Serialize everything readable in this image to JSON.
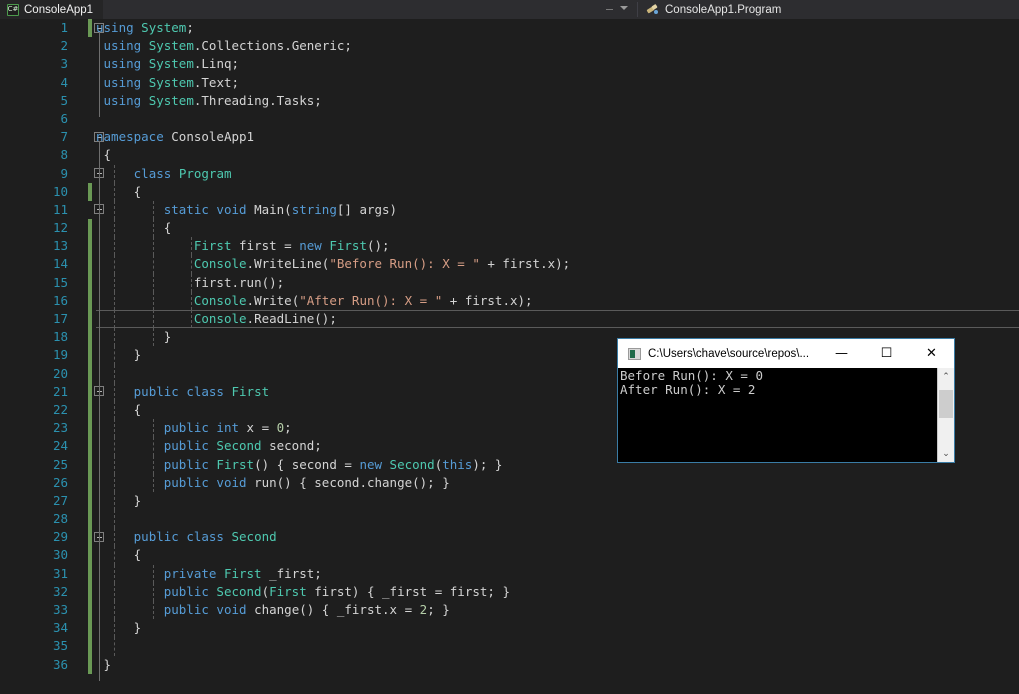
{
  "window": {
    "tab_title": "ConsoleApp1",
    "tab_icon": "csharp-file-icon",
    "nav_caret_icon": "chevron-down-icon",
    "nav_member_icon": "method-icon",
    "nav_member": "ConsoleApp1.Program"
  },
  "editor": {
    "current_line": 17,
    "lines": [
      {
        "n": "1",
        "text": "using System;",
        "fold": "collapse",
        "change": "green",
        "guides": []
      },
      {
        "n": "2",
        "text": " using System.Collections.Generic;",
        "fold": "none",
        "change": "none",
        "guides": []
      },
      {
        "n": "3",
        "text": " using System.Linq;",
        "fold": "none",
        "change": "none",
        "guides": []
      },
      {
        "n": "4",
        "text": " using System.Text;",
        "fold": "none",
        "change": "none",
        "guides": []
      },
      {
        "n": "5",
        "text": " using System.Threading.Tasks;",
        "fold": "none",
        "change": "none",
        "guides": []
      },
      {
        "n": "6",
        "text": "",
        "fold": "none",
        "change": "none",
        "guides": []
      },
      {
        "n": "7",
        "text": "namespace ConsoleApp1",
        "fold": "collapse",
        "change": "none",
        "guides": []
      },
      {
        "n": "8",
        "text": " {",
        "fold": "none",
        "change": "none",
        "guides": []
      },
      {
        "n": "9",
        "text": "     class Program",
        "fold": "collapse",
        "change": "none",
        "guides": [
          1
        ]
      },
      {
        "n": "10",
        "text": "     {",
        "fold": "none",
        "change": "green",
        "guides": [
          1
        ]
      },
      {
        "n": "11",
        "text": "         static void Main(string[] args)",
        "fold": "collapse",
        "change": "none",
        "guides": [
          1,
          2
        ]
      },
      {
        "n": "12",
        "text": "         {",
        "fold": "none",
        "change": "green",
        "guides": [
          1,
          2
        ]
      },
      {
        "n": "13",
        "text": "             First first = new First();",
        "fold": "none",
        "change": "green",
        "guides": [
          1,
          2,
          3
        ]
      },
      {
        "n": "14",
        "text": "             Console.WriteLine(\"Before Run(): X = \" + first.x);",
        "fold": "none",
        "change": "green",
        "guides": [
          1,
          2,
          3
        ]
      },
      {
        "n": "15",
        "text": "             first.run();",
        "fold": "none",
        "change": "green",
        "guides": [
          1,
          2,
          3
        ]
      },
      {
        "n": "16",
        "text": "             Console.Write(\"After Run(): X = \" + first.x);",
        "fold": "none",
        "change": "green",
        "guides": [
          1,
          2,
          3
        ]
      },
      {
        "n": "17",
        "text": "             Console.ReadLine();",
        "fold": "none",
        "change": "green",
        "guides": [
          1,
          2,
          3
        ]
      },
      {
        "n": "18",
        "text": "         }",
        "fold": "none",
        "change": "green",
        "guides": [
          1,
          2
        ]
      },
      {
        "n": "19",
        "text": "     }",
        "fold": "none",
        "change": "green",
        "guides": [
          1
        ]
      },
      {
        "n": "20",
        "text": "",
        "fold": "none",
        "change": "green",
        "guides": [
          1
        ]
      },
      {
        "n": "21",
        "text": "     public class First",
        "fold": "collapse",
        "change": "green",
        "guides": [
          1
        ]
      },
      {
        "n": "22",
        "text": "     {",
        "fold": "none",
        "change": "green",
        "guides": [
          1
        ]
      },
      {
        "n": "23",
        "text": "         public int x = 0;",
        "fold": "none",
        "change": "green",
        "guides": [
          1,
          2
        ]
      },
      {
        "n": "24",
        "text": "         public Second second;",
        "fold": "none",
        "change": "green",
        "guides": [
          1,
          2
        ]
      },
      {
        "n": "25",
        "text": "         public First() { second = new Second(this); }",
        "fold": "none",
        "change": "green",
        "guides": [
          1,
          2
        ]
      },
      {
        "n": "26",
        "text": "         public void run() { second.change(); }",
        "fold": "none",
        "change": "green",
        "guides": [
          1,
          2
        ]
      },
      {
        "n": "27",
        "text": "     }",
        "fold": "none",
        "change": "green",
        "guides": [
          1
        ]
      },
      {
        "n": "28",
        "text": "",
        "fold": "none",
        "change": "green",
        "guides": [
          1
        ]
      },
      {
        "n": "29",
        "text": "     public class Second",
        "fold": "collapse",
        "change": "green",
        "guides": [
          1
        ]
      },
      {
        "n": "30",
        "text": "     {",
        "fold": "none",
        "change": "green",
        "guides": [
          1
        ]
      },
      {
        "n": "31",
        "text": "         private First _first;",
        "fold": "none",
        "change": "green",
        "guides": [
          1,
          2
        ]
      },
      {
        "n": "32",
        "text": "         public Second(First first) { _first = first; }",
        "fold": "none",
        "change": "green",
        "guides": [
          1,
          2
        ]
      },
      {
        "n": "33",
        "text": "         public void change() { _first.x = 2; }",
        "fold": "none",
        "change": "green",
        "guides": [
          1,
          2
        ]
      },
      {
        "n": "34",
        "text": "     }",
        "fold": "none",
        "change": "green",
        "guides": [
          1
        ]
      },
      {
        "n": "35",
        "text": "",
        "fold": "none",
        "change": "green",
        "guides": [
          1
        ]
      },
      {
        "n": "36",
        "text": " }",
        "fold": "none",
        "change": "green",
        "guides": []
      }
    ]
  },
  "console_window": {
    "icon": "console-app-icon",
    "title": "C:\\Users\\chave\\source\\repos\\...",
    "minimize_label": "—",
    "maximize_label": "☐",
    "close_label": "✕",
    "output": "Before Run(): X = 0\nAfter Run(): X = 2",
    "scroll_up_icon": "⌃",
    "scroll_down_icon": "⌄"
  },
  "colors": {
    "editor_bg": "#1e1e1e",
    "chrome_bg": "#2d2d30",
    "tab_bg": "#252526",
    "line_number": "#2b91af",
    "keyword": "#569cd6",
    "type": "#4ec9b0",
    "string": "#d69d85",
    "number": "#b5cea8",
    "plain": "#d4d4d4",
    "change_bar": "#6a9955",
    "console_border": "#3a7ca5"
  }
}
